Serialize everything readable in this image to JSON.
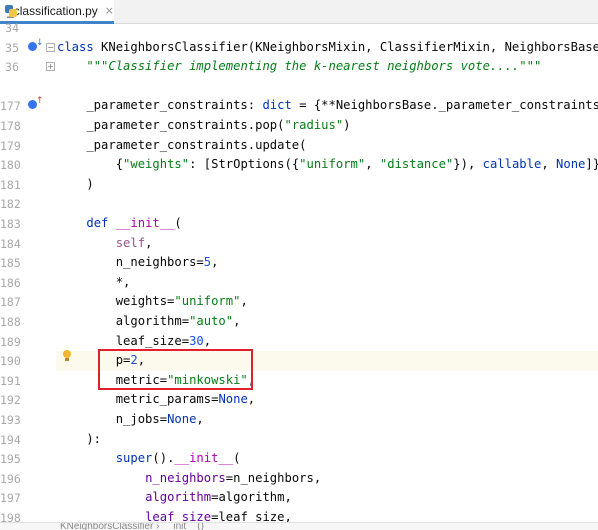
{
  "tab": {
    "label": "_classification.py",
    "close": "×",
    "icon": "python-file-icon"
  },
  "code": [
    {
      "no": "34",
      "segs": []
    },
    {
      "no": "35",
      "segs": [
        [
          "kw",
          "class "
        ],
        [
          "",
          "KNeighborsClassifier(KNeighborsMixin, ClassifierMixin, NeighborsBase):"
        ]
      ]
    },
    {
      "no": "36",
      "segs": [
        [
          "",
          "    "
        ],
        [
          "doc",
          "\"\"\"Classifier implementing the k-nearest neighbors vote....\"\"\""
        ]
      ]
    },
    {
      "no": "",
      "segs": []
    },
    {
      "no": "177",
      "segs": [
        [
          "",
          "    _parameter_constraints: "
        ],
        [
          "kw",
          "dict"
        ],
        [
          "",
          " = {**NeighborsBase._parameter_constraints}"
        ]
      ]
    },
    {
      "no": "178",
      "segs": [
        [
          "",
          "    _parameter_constraints.pop("
        ],
        [
          "str",
          "\"radius\""
        ],
        [
          "",
          ")"
        ]
      ]
    },
    {
      "no": "179",
      "segs": [
        [
          "",
          "    _parameter_constraints.update("
        ]
      ]
    },
    {
      "no": "180",
      "segs": [
        [
          "",
          "        {"
        ],
        [
          "str",
          "\"weights\""
        ],
        [
          "",
          ": [StrOptions({"
        ],
        [
          "str",
          "\"uniform\""
        ],
        [
          "",
          ", "
        ],
        [
          "str",
          "\"distance\""
        ],
        [
          "",
          "}), "
        ],
        [
          "kw",
          "callable"
        ],
        [
          "",
          ", "
        ],
        [
          "kw",
          "None"
        ],
        [
          "",
          "]}"
        ]
      ]
    },
    {
      "no": "181",
      "segs": [
        [
          "",
          "    )"
        ]
      ]
    },
    {
      "no": "182",
      "segs": []
    },
    {
      "no": "183",
      "segs": [
        [
          "",
          "    "
        ],
        [
          "kw",
          "def "
        ],
        [
          "dunder",
          "__init__"
        ],
        [
          "",
          "("
        ]
      ]
    },
    {
      "no": "184",
      "segs": [
        [
          "",
          "        "
        ],
        [
          "self",
          "self"
        ],
        [
          "",
          ","
        ]
      ]
    },
    {
      "no": "185",
      "segs": [
        [
          "",
          "        n_neighbors="
        ],
        [
          "num",
          "5"
        ],
        [
          "",
          ","
        ]
      ]
    },
    {
      "no": "186",
      "segs": [
        [
          "",
          "        *,"
        ]
      ]
    },
    {
      "no": "187",
      "segs": [
        [
          "",
          "        weights="
        ],
        [
          "str",
          "\"uniform\""
        ],
        [
          "",
          ","
        ]
      ]
    },
    {
      "no": "188",
      "segs": [
        [
          "",
          "        algorithm="
        ],
        [
          "str",
          "\"auto\""
        ],
        [
          "",
          ","
        ]
      ]
    },
    {
      "no": "189",
      "segs": [
        [
          "",
          "        leaf_size="
        ],
        [
          "num",
          "30"
        ],
        [
          "",
          ","
        ]
      ]
    },
    {
      "no": "190",
      "segs": [
        [
          "",
          "        p="
        ],
        [
          "num",
          "2"
        ],
        [
          "",
          ","
        ]
      ]
    },
    {
      "no": "191",
      "segs": [
        [
          "",
          "        metric="
        ],
        [
          "str",
          "\"minkowski\""
        ],
        [
          "",
          ","
        ]
      ]
    },
    {
      "no": "192",
      "segs": [
        [
          "",
          "        metric_params="
        ],
        [
          "kw",
          "None"
        ],
        [
          "",
          ","
        ]
      ]
    },
    {
      "no": "193",
      "segs": [
        [
          "",
          "        n_jobs="
        ],
        [
          "kw",
          "None"
        ],
        [
          "",
          ","
        ]
      ]
    },
    {
      "no": "194",
      "segs": [
        [
          "",
          "    ):"
        ]
      ]
    },
    {
      "no": "195",
      "segs": [
        [
          "",
          "        "
        ],
        [
          "kw",
          "super"
        ],
        [
          "",
          "()."
        ],
        [
          "dunder",
          "__init__"
        ],
        [
          "",
          "("
        ]
      ]
    },
    {
      "no": "196",
      "segs": [
        [
          "",
          "            "
        ],
        [
          "param",
          "n_neighbors"
        ],
        [
          "",
          "=n_neighbors,"
        ]
      ]
    },
    {
      "no": "197",
      "segs": [
        [
          "",
          "            "
        ],
        [
          "param",
          "algorithm"
        ],
        [
          "",
          "=algorithm,"
        ]
      ]
    },
    {
      "no": "198",
      "segs": [
        [
          "",
          "            "
        ],
        [
          "param",
          "leaf_size"
        ],
        [
          "",
          "=leaf_size,"
        ]
      ]
    }
  ],
  "breadcrumb": "KNeighborsClassifier  ›  __init__()",
  "colors": {
    "keyword": "#0033b3",
    "string": "#067d17",
    "number": "#1750eb",
    "highlight": "#e0202a"
  }
}
